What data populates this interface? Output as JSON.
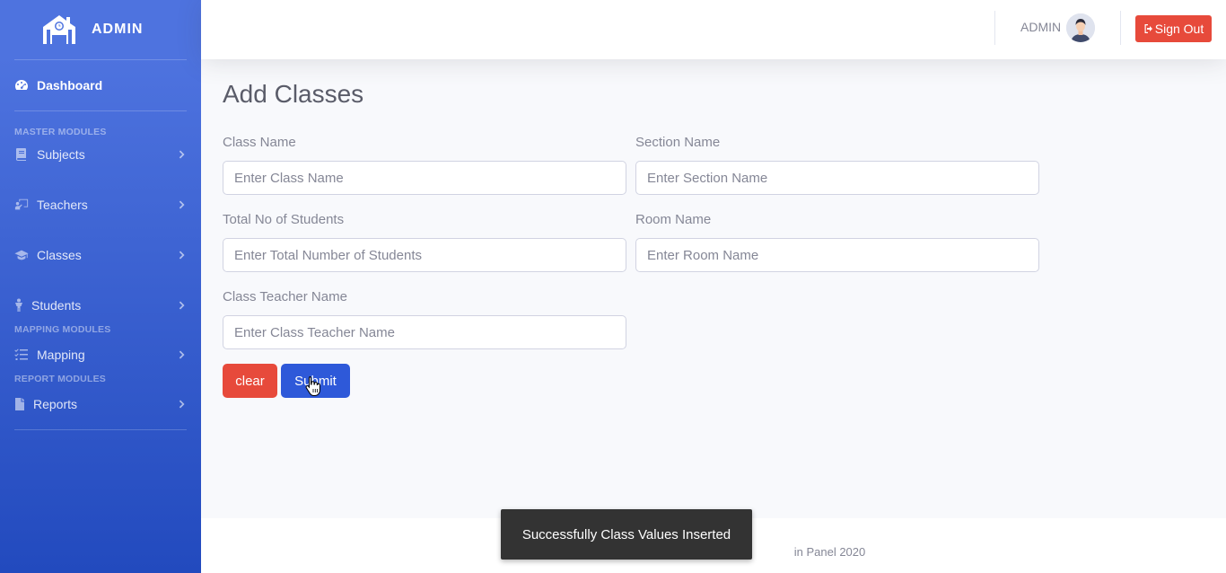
{
  "brand": {
    "name": "ADMIN",
    "icon": "school-icon"
  },
  "sidebar": {
    "dashboard": {
      "label": "Dashboard",
      "icon": "tachometer-icon"
    },
    "headings": {
      "master": "MASTER MODULES",
      "mapping": "MAPPING MODULES",
      "report": "REPORT MODULES"
    },
    "items": [
      {
        "label": "Subjects",
        "icon": "book-icon"
      },
      {
        "label": "Teachers",
        "icon": "chalkboard-teacher-icon"
      },
      {
        "label": "Classes",
        "icon": "graduation-cap-icon"
      },
      {
        "label": "Students",
        "icon": "user-child-icon"
      },
      {
        "label": "Mapping",
        "icon": "tasks-icon"
      },
      {
        "label": "Reports",
        "icon": "file-icon"
      }
    ]
  },
  "topbar": {
    "user": "ADMIN",
    "signout": "Sign Out"
  },
  "page": {
    "title": "Add Classes",
    "fields": {
      "class_name": {
        "label": "Class Name",
        "placeholder": "Enter Class Name",
        "value": ""
      },
      "section_name": {
        "label": "Section Name",
        "placeholder": "Enter Section Name",
        "value": ""
      },
      "total_students": {
        "label": "Total No of Students",
        "placeholder": "Enter Total Number of Students",
        "value": ""
      },
      "room_name": {
        "label": "Room Name",
        "placeholder": "Enter Room Name",
        "value": ""
      },
      "class_teacher": {
        "label": "Class Teacher Name",
        "placeholder": "Enter Class Teacher Name",
        "value": ""
      }
    },
    "buttons": {
      "clear": "clear",
      "submit": "Submit"
    }
  },
  "footer": {
    "text": "in Panel 2020"
  },
  "toast": {
    "message": "Successfully Class Values Inserted"
  },
  "colors": {
    "sidebar": "#4e73df",
    "danger": "#e74a3b",
    "primary": "#2e59d9"
  }
}
